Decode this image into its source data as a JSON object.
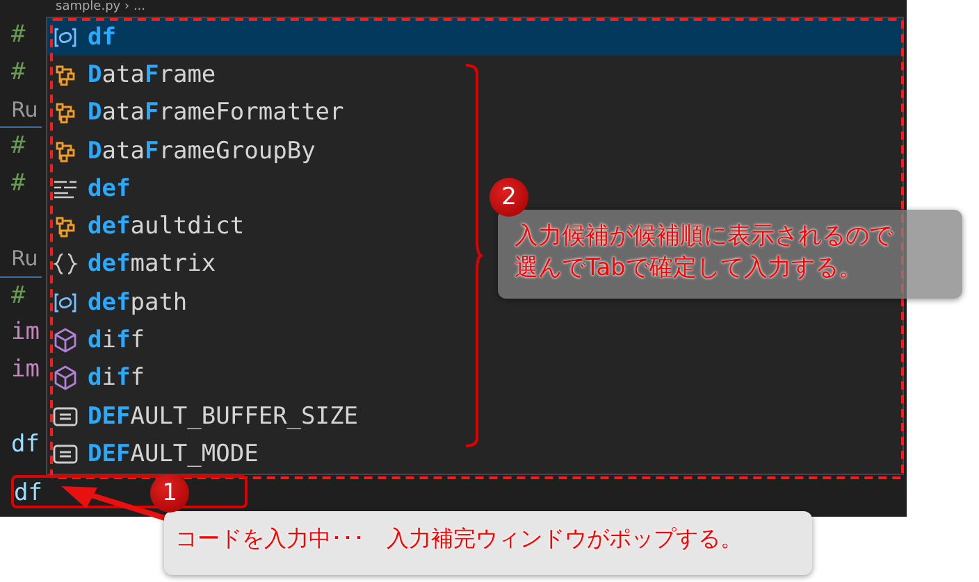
{
  "editor": {
    "breadcrumb": "sample.py › ...",
    "lines": [
      {
        "kind": "comment",
        "text": "#"
      },
      {
        "kind": "comment",
        "text": "#"
      },
      {
        "kind": "codelens",
        "text": "Ru"
      },
      {
        "kind": "comment",
        "text": "#"
      },
      {
        "kind": "comment",
        "text": "#"
      },
      {
        "kind": "blank"
      },
      {
        "kind": "codelens",
        "text": "Ru"
      },
      {
        "kind": "comment",
        "text": "#"
      },
      {
        "kind": "keyword",
        "text": "im"
      },
      {
        "kind": "keyword",
        "text": "im"
      },
      {
        "kind": "blank"
      },
      {
        "kind": "identifier",
        "text": "df"
      }
    ],
    "current_line": "df"
  },
  "suggest": {
    "items": [
      {
        "kind": "variable",
        "selected": true,
        "parts": [
          {
            "text": "df",
            "match": true
          }
        ]
      },
      {
        "kind": "class",
        "selected": false,
        "parts": [
          {
            "text": "D",
            "match": true
          },
          {
            "text": "ata",
            "match": false
          },
          {
            "text": "F",
            "match": true
          },
          {
            "text": "rame",
            "match": false
          }
        ]
      },
      {
        "kind": "class",
        "selected": false,
        "parts": [
          {
            "text": "D",
            "match": true
          },
          {
            "text": "ata",
            "match": false
          },
          {
            "text": "F",
            "match": true
          },
          {
            "text": "rameFormatter",
            "match": false
          }
        ]
      },
      {
        "kind": "class",
        "selected": false,
        "parts": [
          {
            "text": "D",
            "match": true
          },
          {
            "text": "ata",
            "match": false
          },
          {
            "text": "F",
            "match": true
          },
          {
            "text": "rameGroupBy",
            "match": false
          }
        ]
      },
      {
        "kind": "keyword",
        "selected": false,
        "parts": [
          {
            "text": "def",
            "match": true
          }
        ]
      },
      {
        "kind": "class",
        "selected": false,
        "parts": [
          {
            "text": "def",
            "match": true
          },
          {
            "text": "aultdict",
            "match": false
          }
        ]
      },
      {
        "kind": "braces",
        "selected": false,
        "parts": [
          {
            "text": "def",
            "match": true
          },
          {
            "text": "matrix",
            "match": false
          }
        ]
      },
      {
        "kind": "variable",
        "selected": false,
        "parts": [
          {
            "text": "def",
            "match": true
          },
          {
            "text": "path",
            "match": false
          }
        ]
      },
      {
        "kind": "module",
        "selected": false,
        "parts": [
          {
            "text": "d",
            "match": true
          },
          {
            "text": "i",
            "match": false
          },
          {
            "text": "f",
            "match": true
          },
          {
            "text": "f",
            "match": false
          }
        ]
      },
      {
        "kind": "module",
        "selected": false,
        "parts": [
          {
            "text": "d",
            "match": true
          },
          {
            "text": "i",
            "match": false
          },
          {
            "text": "f",
            "match": true
          },
          {
            "text": "f",
            "match": false
          }
        ]
      },
      {
        "kind": "constant",
        "selected": false,
        "parts": [
          {
            "text": "DEF",
            "match": true
          },
          {
            "text": "AULT_BUFFER_SIZE",
            "match": false
          }
        ]
      },
      {
        "kind": "constant",
        "selected": false,
        "parts": [
          {
            "text": "DEF",
            "match": true
          },
          {
            "text": "AULT_MODE",
            "match": false
          }
        ]
      }
    ]
  },
  "annotations": [
    {
      "number": "1",
      "lines": [
        "コードを入力中･･･　入力補完ウィンドウがポップする。"
      ]
    },
    {
      "number": "2",
      "lines": [
        "入力候補が候補順に表示されるので",
        "選んでTabで確定して入力する。"
      ]
    }
  ]
}
